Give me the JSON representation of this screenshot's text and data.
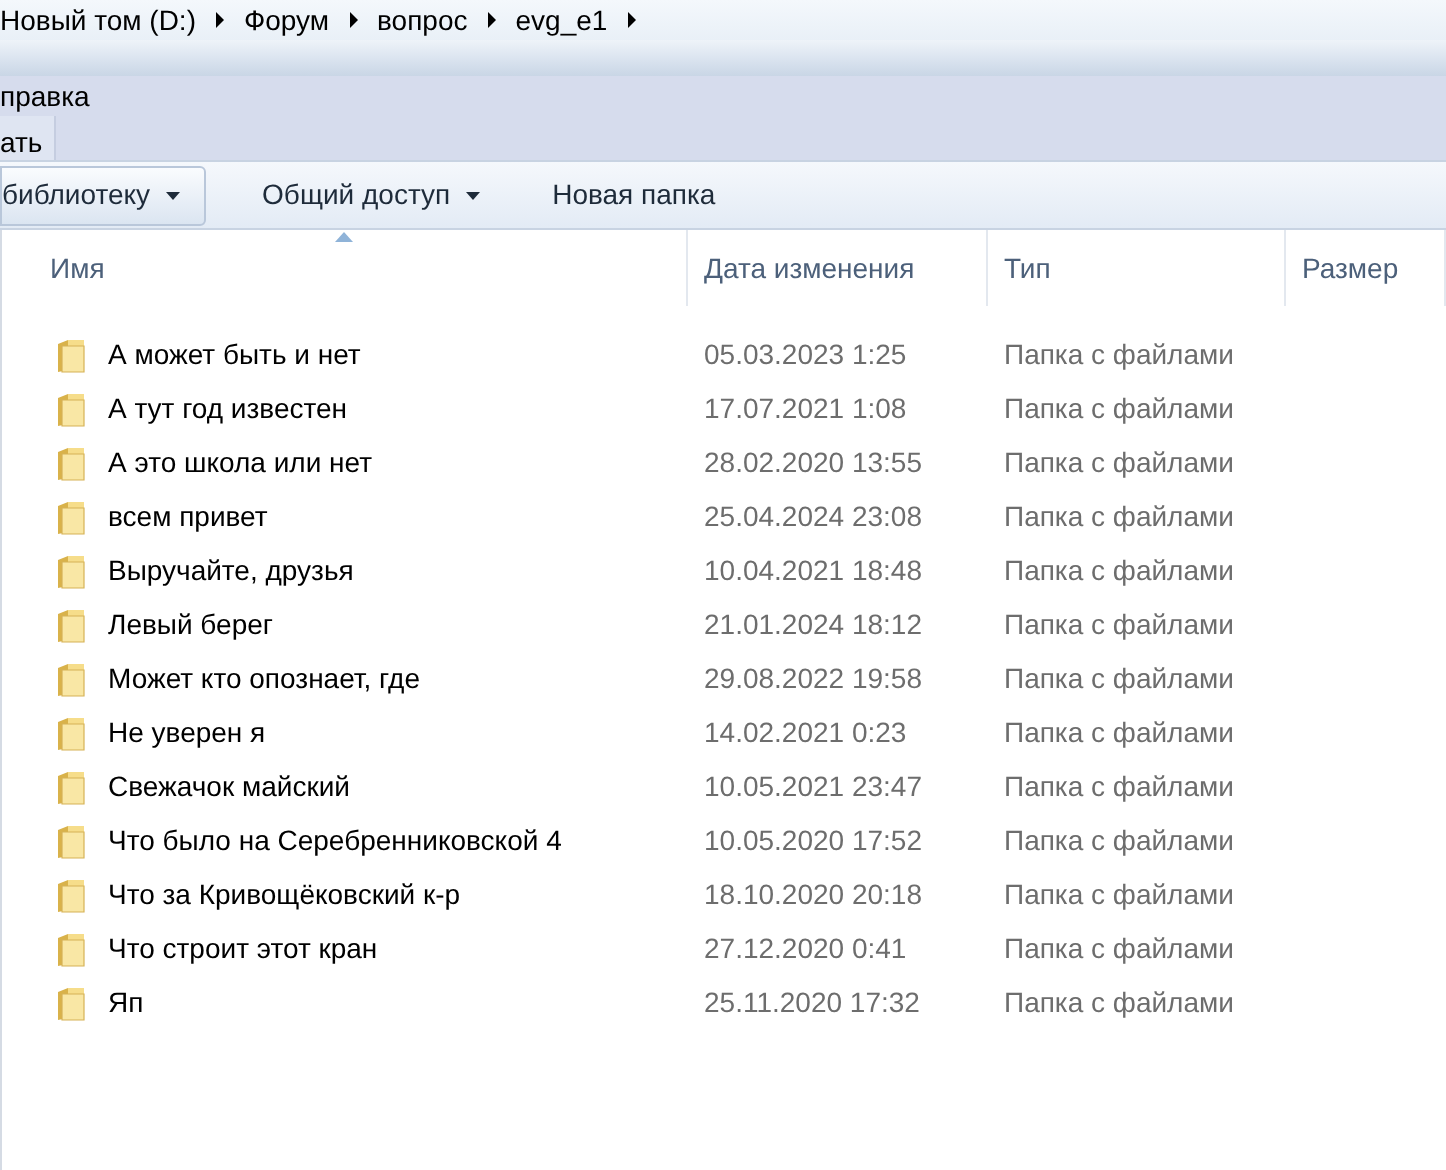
{
  "breadcrumbs": [
    "Новый том (D:)",
    "Форум",
    "вопрос",
    "evg_e1"
  ],
  "menu_bar": [
    "правка"
  ],
  "menu_bar_2": [
    "ать"
  ],
  "toolbar": [
    {
      "label": "библиотеку",
      "dropdown": true
    },
    {
      "label": "Общий доступ",
      "dropdown": true
    },
    {
      "label": "Новая папка",
      "dropdown": false
    }
  ],
  "columns": [
    {
      "label": "Имя",
      "sorted": true
    },
    {
      "label": "Дата изменения",
      "sorted": false
    },
    {
      "label": "Тип",
      "sorted": false
    },
    {
      "label": "Размер",
      "sorted": false
    }
  ],
  "rows": [
    {
      "name": "А может быть и нет",
      "date": "05.03.2023 1:25",
      "type": "Папка с файлами"
    },
    {
      "name": "А тут год известен",
      "date": "17.07.2021 1:08",
      "type": "Папка с файлами"
    },
    {
      "name": "А это школа или нет",
      "date": "28.02.2020 13:55",
      "type": "Папка с файлами"
    },
    {
      "name": "всем привет",
      "date": "25.04.2024 23:08",
      "type": "Папка с файлами"
    },
    {
      "name": "Выручайте, друзья",
      "date": "10.04.2021 18:48",
      "type": "Папка с файлами"
    },
    {
      "name": "Левый берег",
      "date": "21.01.2024 18:12",
      "type": "Папка с файлами"
    },
    {
      "name": "Может кто опознает, где",
      "date": "29.08.2022 19:58",
      "type": "Папка с файлами"
    },
    {
      "name": "Не уверен я",
      "date": "14.02.2021 0:23",
      "type": "Папка с файлами"
    },
    {
      "name": "Свежачок майский",
      "date": "10.05.2021 23:47",
      "type": "Папка с файлами"
    },
    {
      "name": "Что было на Серебренниковской 4",
      "date": "10.05.2020 17:52",
      "type": "Папка с файлами"
    },
    {
      "name": "Что за Кривощёковский к-р",
      "date": "18.10.2020 20:18",
      "type": "Папка с файлами"
    },
    {
      "name": "Что строит этот кран",
      "date": "27.12.2020 0:41",
      "type": "Папка с файлами"
    },
    {
      "name": "Яп",
      "date": "25.11.2020 17:32",
      "type": "Папка с файлами"
    }
  ]
}
